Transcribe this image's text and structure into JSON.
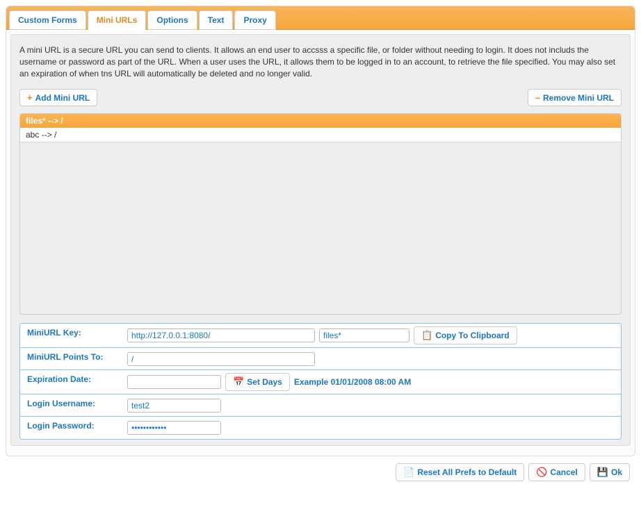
{
  "tabs": [
    {
      "label": "Custom Forms",
      "active": false
    },
    {
      "label": "Mini URLs",
      "active": true
    },
    {
      "label": "Options",
      "active": false
    },
    {
      "label": "Text",
      "active": false
    },
    {
      "label": "Proxy",
      "active": false
    }
  ],
  "description": "A mini URL is a secure URL you can send to clients. It allows an end user to accsss a specific file, or folder without needing to login. It does not includs the username or password as part of the URL. When a user uses the URL, it allows them to be logged in to an account, to retrieve the file specified. You may also set an expiration of when tns URL will automatically be deleted and no longer valid.",
  "buttons": {
    "add": "Add Mini URL",
    "remove": "Remove Mini URL",
    "copy": "Copy To Clipboard",
    "set_days": "Set Days",
    "reset": "Reset All Prefs to Default",
    "cancel": "Cancel",
    "ok": "Ok"
  },
  "list": {
    "header": "files* --> /",
    "rows": [
      "abc --> /"
    ]
  },
  "form": {
    "key": {
      "label": "MiniURL Key:",
      "base": "http://127.0.0.1:8080/",
      "key": "files*"
    },
    "points": {
      "label": "MiniURL Points To:",
      "value": "/"
    },
    "expiry": {
      "label": "Expiration Date:",
      "value": "",
      "example": "Example 01/01/2008 08:00 AM"
    },
    "user": {
      "label": "Login Username:",
      "value": "test2"
    },
    "pass": {
      "label": "Login Password:",
      "value": "************"
    }
  }
}
